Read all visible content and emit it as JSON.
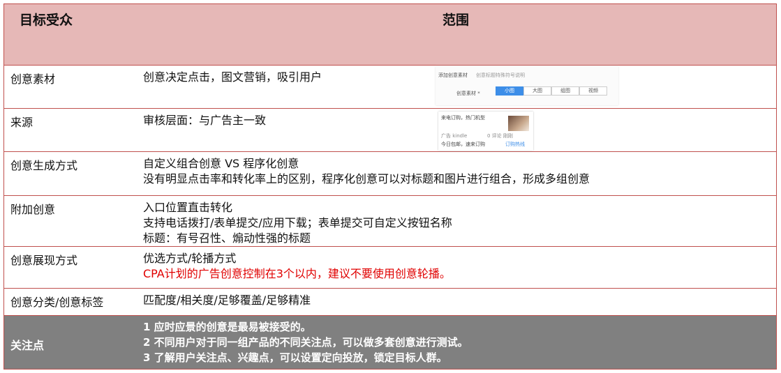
{
  "header": {
    "left": "目标受众",
    "right": "范围"
  },
  "rows": [
    {
      "label": "创意素材",
      "lines": [
        "创意决定点击，图文营销，吸引用户"
      ]
    },
    {
      "label": "来源",
      "lines": [
        "审核层面：与广告主一致"
      ]
    },
    {
      "label": "创意生成方式",
      "lines": [
        "自定义组合创意 VS 程序化创意",
        "没有明显点击率和转化率上的区别，程序化创意可以对标题和图片进行组合，形成多组创意"
      ]
    },
    {
      "label": "附加创意",
      "lines": [
        "入口位置直击转化",
        "支持电话拨打/表单提交/应用下载；表单提交可自定义按钮名称",
        "标题：有号召性、煽动性强的标题"
      ]
    },
    {
      "label": "创意展现方式",
      "lines": [
        "优选方式/轮播方式",
        "CPA计划的广告创意控制在3个以内，建议不要使用创意轮播。"
      ]
    },
    {
      "label": "创意分类/创意标签",
      "lines": [
        "匹配度/相关度/足够覆盖/足够精准"
      ]
    }
  ],
  "footer": {
    "label": "关注点",
    "lines": [
      "1 应时应景的创意是最易被接受的。",
      "2 不同用户对于同一组产品的不同关注点，可以做多套创意进行测试。",
      "3 了解用户关注点、兴趣点，可以设置定向投放，锁定目标人群。"
    ]
  },
  "thumb1": {
    "title": "添加创意素材",
    "hint": "创意标题特殊符号说明",
    "field": "创意素材 *",
    "options": [
      "小图",
      "大图",
      "组图",
      "视频"
    ]
  },
  "thumb2": {
    "line1": "来电订购，热门机型",
    "line2": "广告 kindle",
    "line3": "0 评论 刚刚",
    "line4": "今日包邮，速来订购",
    "line5": "订购热线"
  },
  "colors": {
    "header_bg": "#e6b8b7",
    "border": "#c0504d",
    "footer_bg": "#808080",
    "highlight": "#e00000"
  }
}
